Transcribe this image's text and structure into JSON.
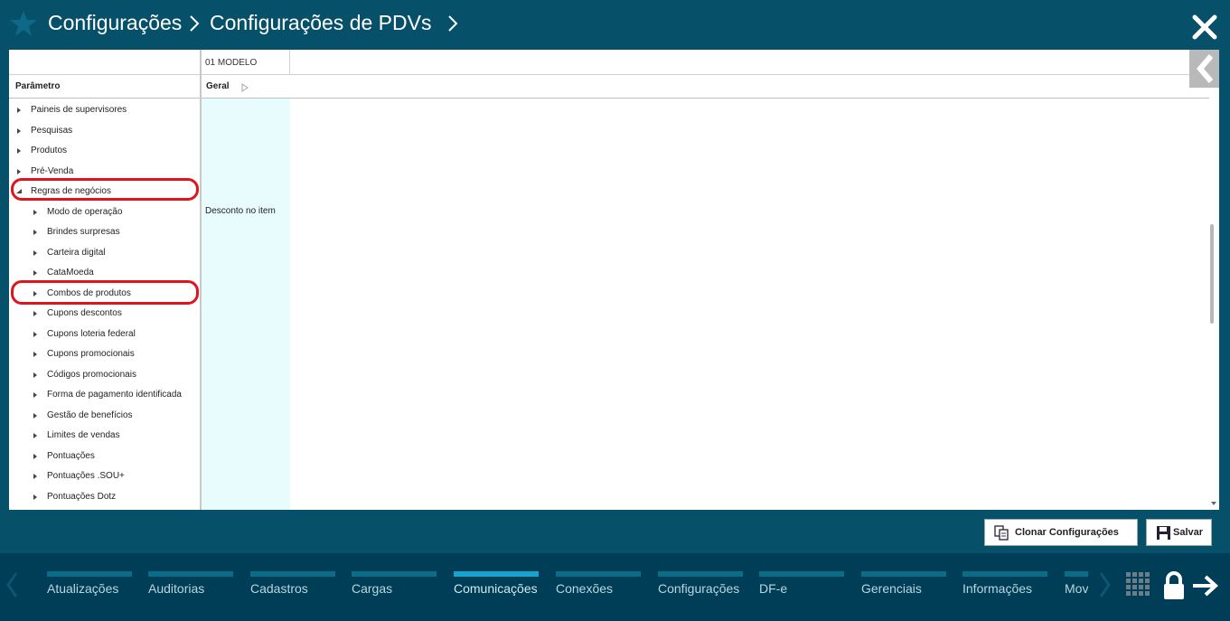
{
  "header": {
    "crumbs": [
      "Configurações",
      "Configurações de PDVs"
    ]
  },
  "grid": {
    "model_column": "01 MODELO",
    "param_header": "Parâmetro",
    "group_header": "Geral",
    "value_cell": "Desconto no item"
  },
  "tree": {
    "items": [
      {
        "label": "Paineis de supervisores",
        "level": 0,
        "expanded": false
      },
      {
        "label": "Pesquisas",
        "level": 0,
        "expanded": false
      },
      {
        "label": "Produtos",
        "level": 0,
        "expanded": false
      },
      {
        "label": "Pré-Venda",
        "level": 0,
        "expanded": false
      },
      {
        "label": "Regras de negócios",
        "level": 0,
        "expanded": true,
        "highlighted": true
      },
      {
        "label": "Modo de operação",
        "level": 1,
        "expanded": false
      },
      {
        "label": "Brindes surpresas",
        "level": 1,
        "expanded": false
      },
      {
        "label": "Carteira digital",
        "level": 1,
        "expanded": false
      },
      {
        "label": "CataMoeda",
        "level": 1,
        "expanded": false
      },
      {
        "label": "Combos de produtos",
        "level": 1,
        "expanded": false,
        "highlighted": true
      },
      {
        "label": "Cupons descontos",
        "level": 1,
        "expanded": false
      },
      {
        "label": "Cupons loteria federal",
        "level": 1,
        "expanded": false
      },
      {
        "label": "Cupons promocionais",
        "level": 1,
        "expanded": false
      },
      {
        "label": "Códigos promocionais",
        "level": 1,
        "expanded": false
      },
      {
        "label": "Forma de pagamento identificada",
        "level": 1,
        "expanded": false
      },
      {
        "label": "Gestão de benefícios",
        "level": 1,
        "expanded": false
      },
      {
        "label": "Limites de vendas",
        "level": 1,
        "expanded": false
      },
      {
        "label": "Pontuações",
        "level": 1,
        "expanded": false
      },
      {
        "label": "Pontuações .SOU+",
        "level": 1,
        "expanded": false
      },
      {
        "label": "Pontuações Dotz",
        "level": 1,
        "expanded": false
      }
    ]
  },
  "actions": {
    "clone_label": "Clonar Configurações",
    "save_label": "Salvar"
  },
  "bottom_menu": {
    "items": [
      {
        "label": "Atualizações",
        "active": false
      },
      {
        "label": "Auditorias",
        "active": false
      },
      {
        "label": "Cadastros",
        "active": false
      },
      {
        "label": "Cargas",
        "active": false
      },
      {
        "label": "Comunicações",
        "active": true
      },
      {
        "label": "Conexões",
        "active": false
      },
      {
        "label": "Configurações",
        "active": false
      },
      {
        "label": "DF-e",
        "active": false
      },
      {
        "label": "Gerenciais",
        "active": false
      },
      {
        "label": "Informações",
        "active": false
      },
      {
        "label": "Mov",
        "active": false
      }
    ]
  },
  "colors": {
    "header_bg": "#07506a",
    "bottom_bg": "#003d56",
    "highlight": "#e0141e",
    "value_column_bg": "#e8fbfd"
  }
}
